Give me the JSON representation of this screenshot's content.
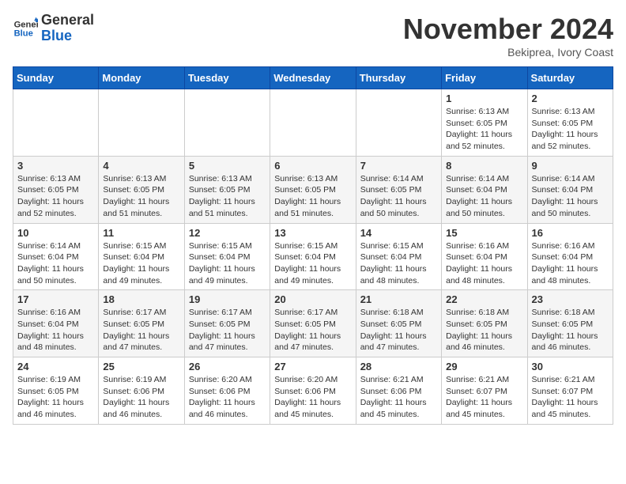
{
  "header": {
    "logo_general": "General",
    "logo_blue": "Blue",
    "month_title": "November 2024",
    "location": "Bekiprea, Ivory Coast"
  },
  "days_of_week": [
    "Sunday",
    "Monday",
    "Tuesday",
    "Wednesday",
    "Thursday",
    "Friday",
    "Saturday"
  ],
  "weeks": [
    [
      {
        "day": "",
        "info": ""
      },
      {
        "day": "",
        "info": ""
      },
      {
        "day": "",
        "info": ""
      },
      {
        "day": "",
        "info": ""
      },
      {
        "day": "",
        "info": ""
      },
      {
        "day": "1",
        "info": "Sunrise: 6:13 AM\nSunset: 6:05 PM\nDaylight: 11 hours and 52 minutes."
      },
      {
        "day": "2",
        "info": "Sunrise: 6:13 AM\nSunset: 6:05 PM\nDaylight: 11 hours and 52 minutes."
      }
    ],
    [
      {
        "day": "3",
        "info": "Sunrise: 6:13 AM\nSunset: 6:05 PM\nDaylight: 11 hours and 52 minutes."
      },
      {
        "day": "4",
        "info": "Sunrise: 6:13 AM\nSunset: 6:05 PM\nDaylight: 11 hours and 51 minutes."
      },
      {
        "day": "5",
        "info": "Sunrise: 6:13 AM\nSunset: 6:05 PM\nDaylight: 11 hours and 51 minutes."
      },
      {
        "day": "6",
        "info": "Sunrise: 6:13 AM\nSunset: 6:05 PM\nDaylight: 11 hours and 51 minutes."
      },
      {
        "day": "7",
        "info": "Sunrise: 6:14 AM\nSunset: 6:05 PM\nDaylight: 11 hours and 50 minutes."
      },
      {
        "day": "8",
        "info": "Sunrise: 6:14 AM\nSunset: 6:04 PM\nDaylight: 11 hours and 50 minutes."
      },
      {
        "day": "9",
        "info": "Sunrise: 6:14 AM\nSunset: 6:04 PM\nDaylight: 11 hours and 50 minutes."
      }
    ],
    [
      {
        "day": "10",
        "info": "Sunrise: 6:14 AM\nSunset: 6:04 PM\nDaylight: 11 hours and 50 minutes."
      },
      {
        "day": "11",
        "info": "Sunrise: 6:15 AM\nSunset: 6:04 PM\nDaylight: 11 hours and 49 minutes."
      },
      {
        "day": "12",
        "info": "Sunrise: 6:15 AM\nSunset: 6:04 PM\nDaylight: 11 hours and 49 minutes."
      },
      {
        "day": "13",
        "info": "Sunrise: 6:15 AM\nSunset: 6:04 PM\nDaylight: 11 hours and 49 minutes."
      },
      {
        "day": "14",
        "info": "Sunrise: 6:15 AM\nSunset: 6:04 PM\nDaylight: 11 hours and 48 minutes."
      },
      {
        "day": "15",
        "info": "Sunrise: 6:16 AM\nSunset: 6:04 PM\nDaylight: 11 hours and 48 minutes."
      },
      {
        "day": "16",
        "info": "Sunrise: 6:16 AM\nSunset: 6:04 PM\nDaylight: 11 hours and 48 minutes."
      }
    ],
    [
      {
        "day": "17",
        "info": "Sunrise: 6:16 AM\nSunset: 6:04 PM\nDaylight: 11 hours and 48 minutes."
      },
      {
        "day": "18",
        "info": "Sunrise: 6:17 AM\nSunset: 6:05 PM\nDaylight: 11 hours and 47 minutes."
      },
      {
        "day": "19",
        "info": "Sunrise: 6:17 AM\nSunset: 6:05 PM\nDaylight: 11 hours and 47 minutes."
      },
      {
        "day": "20",
        "info": "Sunrise: 6:17 AM\nSunset: 6:05 PM\nDaylight: 11 hours and 47 minutes."
      },
      {
        "day": "21",
        "info": "Sunrise: 6:18 AM\nSunset: 6:05 PM\nDaylight: 11 hours and 47 minutes."
      },
      {
        "day": "22",
        "info": "Sunrise: 6:18 AM\nSunset: 6:05 PM\nDaylight: 11 hours and 46 minutes."
      },
      {
        "day": "23",
        "info": "Sunrise: 6:18 AM\nSunset: 6:05 PM\nDaylight: 11 hours and 46 minutes."
      }
    ],
    [
      {
        "day": "24",
        "info": "Sunrise: 6:19 AM\nSunset: 6:05 PM\nDaylight: 11 hours and 46 minutes."
      },
      {
        "day": "25",
        "info": "Sunrise: 6:19 AM\nSunset: 6:06 PM\nDaylight: 11 hours and 46 minutes."
      },
      {
        "day": "26",
        "info": "Sunrise: 6:20 AM\nSunset: 6:06 PM\nDaylight: 11 hours and 46 minutes."
      },
      {
        "day": "27",
        "info": "Sunrise: 6:20 AM\nSunset: 6:06 PM\nDaylight: 11 hours and 45 minutes."
      },
      {
        "day": "28",
        "info": "Sunrise: 6:21 AM\nSunset: 6:06 PM\nDaylight: 11 hours and 45 minutes."
      },
      {
        "day": "29",
        "info": "Sunrise: 6:21 AM\nSunset: 6:07 PM\nDaylight: 11 hours and 45 minutes."
      },
      {
        "day": "30",
        "info": "Sunrise: 6:21 AM\nSunset: 6:07 PM\nDaylight: 11 hours and 45 minutes."
      }
    ]
  ]
}
